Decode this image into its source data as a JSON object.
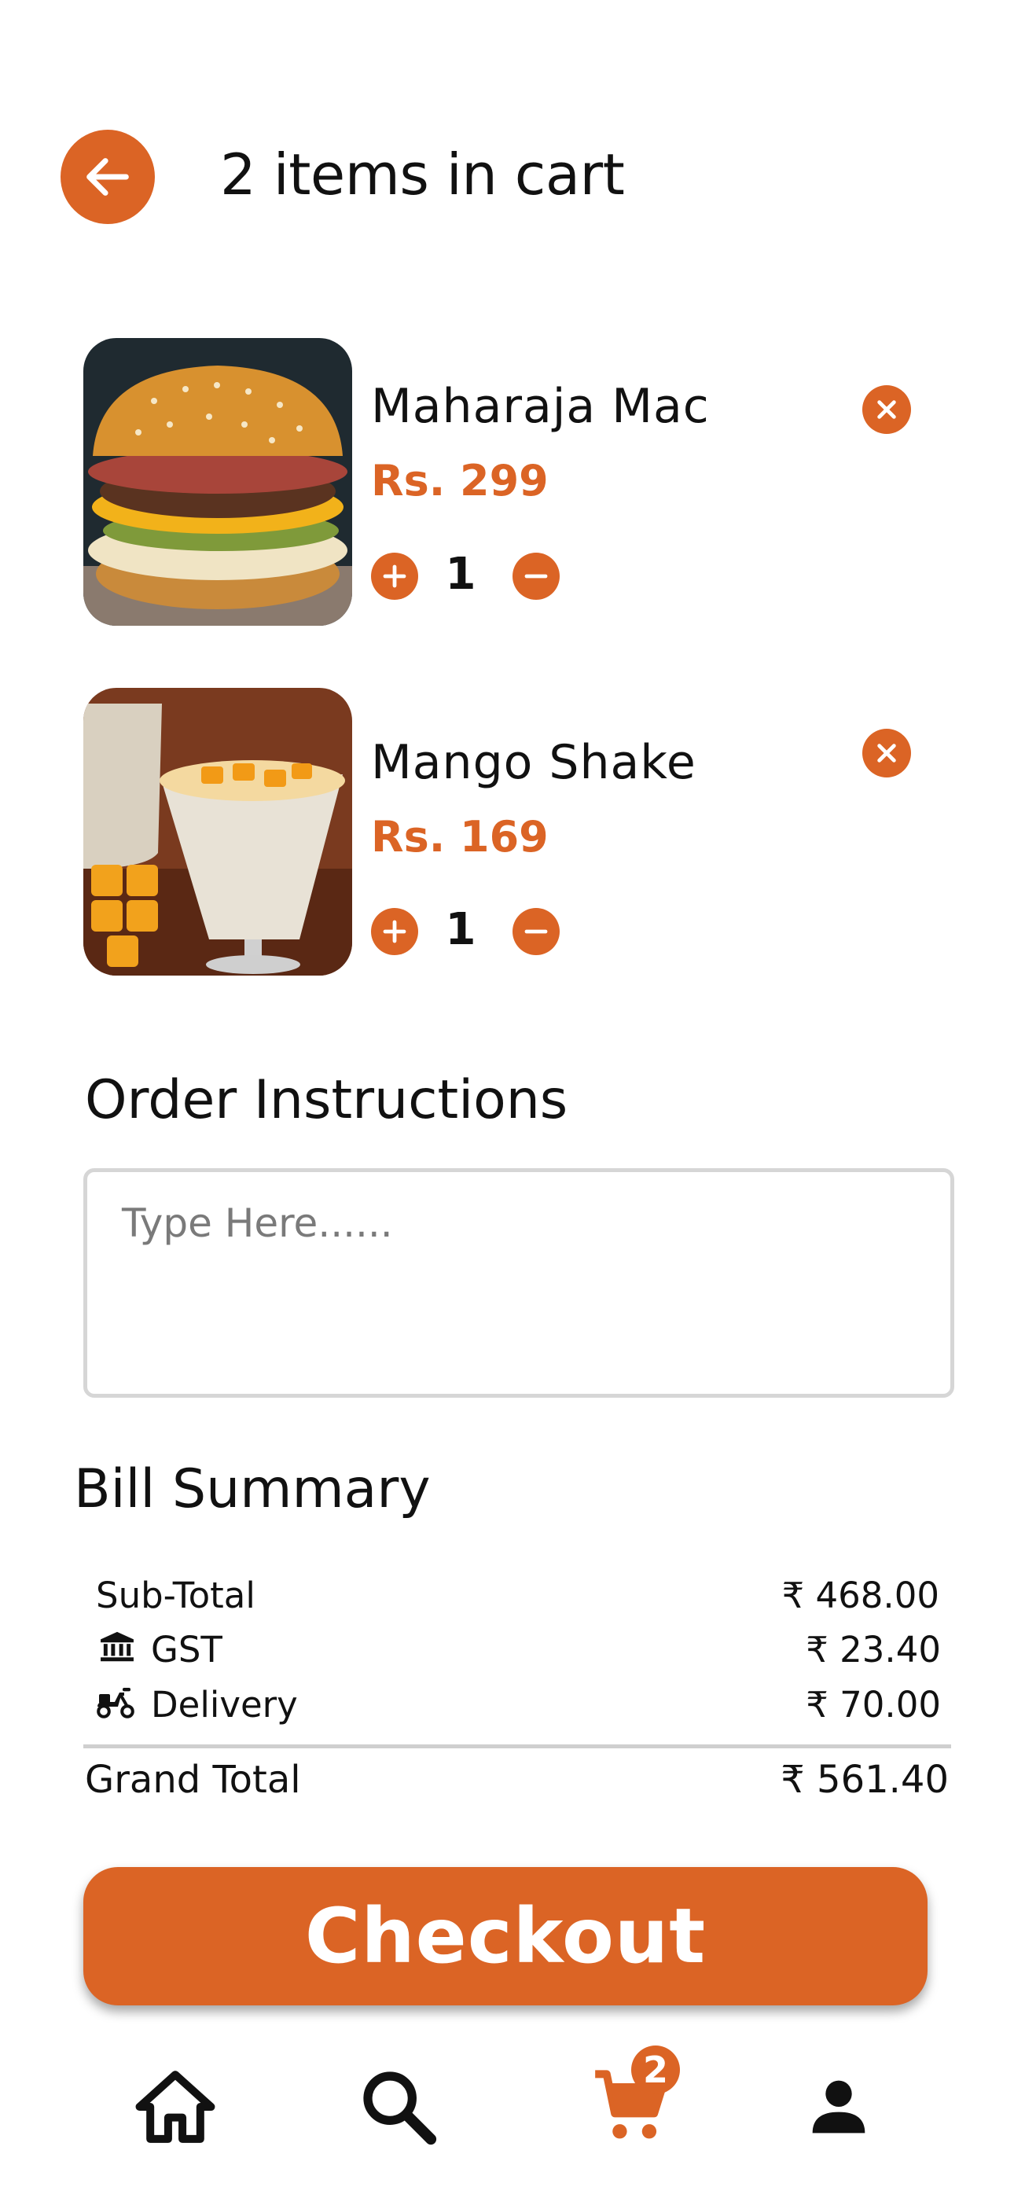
{
  "header": {
    "title": "2 items in cart"
  },
  "cart": {
    "items": [
      {
        "name": "Maharaja Mac",
        "price": "Rs. 299",
        "qty": "1",
        "image": "burger-image"
      },
      {
        "name": "Mango Shake",
        "price": "Rs. 169",
        "qty": "1",
        "image": "mango-shake-image"
      }
    ]
  },
  "instructions": {
    "title": "Order Instructions",
    "placeholder": "Type Here......",
    "value": ""
  },
  "bill": {
    "title": "Bill Summary",
    "rows": [
      {
        "label": "Sub-Total",
        "value": "₹ 468.00",
        "icon": ""
      },
      {
        "label": "GST",
        "value": "₹ 23.40",
        "icon": "bank-icon"
      },
      {
        "label": "Delivery",
        "value": "₹ 70.00",
        "icon": "scooter-icon"
      }
    ],
    "grand_total_label": "Grand Total",
    "grand_total_value": "₹ 561.40"
  },
  "checkout": {
    "label": "Checkout"
  },
  "nav": {
    "items": [
      {
        "name": "home",
        "icon": "home-icon"
      },
      {
        "name": "search",
        "icon": "search-icon"
      },
      {
        "name": "cart",
        "icon": "cart-icon",
        "badge": "2",
        "active": true
      },
      {
        "name": "profile",
        "icon": "person-icon"
      }
    ]
  },
  "colors": {
    "accent": "#DB6425",
    "text": "#111111",
    "border": "#d6d6d6"
  }
}
